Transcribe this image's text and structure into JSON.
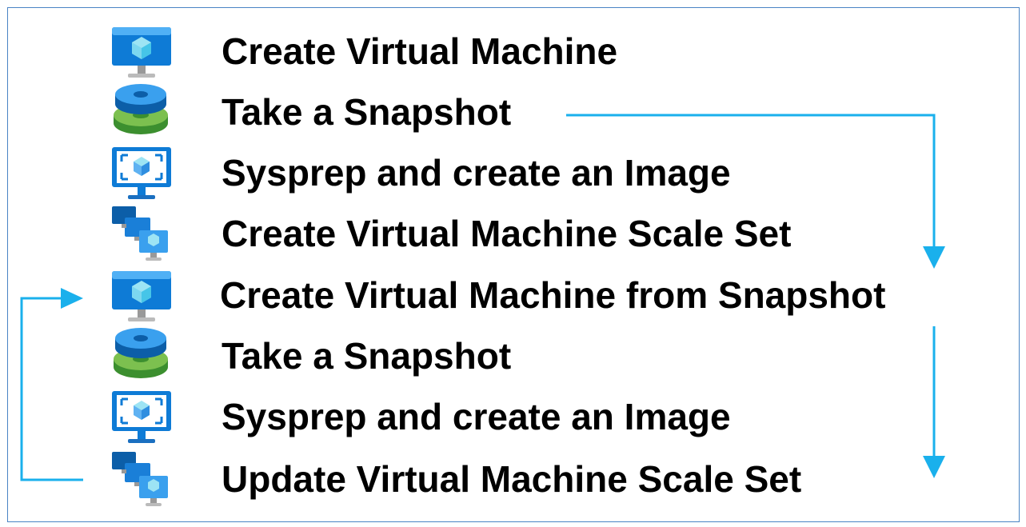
{
  "steps": [
    {
      "label": "Create Virtual Machine",
      "icon": "virtual-machine-icon"
    },
    {
      "label": "Take a Snapshot",
      "icon": "snapshot-disk-icon"
    },
    {
      "label": "Sysprep and create an Image",
      "icon": "vm-image-icon"
    },
    {
      "label": "Create Virtual Machine Scale Set",
      "icon": "vm-scale-set-icon"
    },
    {
      "label": "Create Virtual Machine from Snapshot",
      "icon": "virtual-machine-icon"
    },
    {
      "label": "Take a Snapshot",
      "icon": "snapshot-disk-icon"
    },
    {
      "label": "Sysprep and create an Image",
      "icon": "vm-image-icon"
    },
    {
      "label": "Update Virtual Machine Scale Set",
      "icon": "vm-scale-set-icon"
    }
  ],
  "colors": {
    "arrow": "#1ab0ec",
    "frame_border": "#4a84c4",
    "text": "#000000"
  }
}
